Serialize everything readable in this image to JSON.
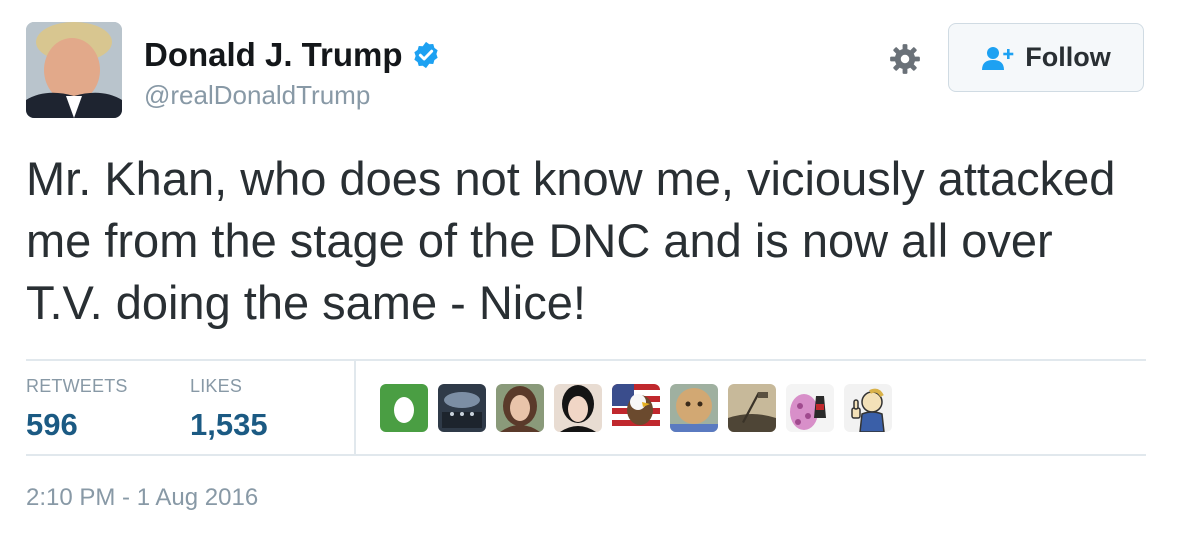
{
  "user": {
    "name": "Donald J. Trump",
    "handle": "@realDonaldTrump",
    "verified": true
  },
  "actions": {
    "follow_label": "Follow"
  },
  "tweet": {
    "text": "Mr. Khan, who does not know me, viciously attacked me from the stage of the DNC and is now all over T.V. doing the same - Nice!"
  },
  "stats": {
    "retweets_label": "RETWEETS",
    "retweets_value": "596",
    "likes_label": "LIKES",
    "likes_value": "1,535"
  },
  "likers": [
    {
      "name": "liker-egg-avatar",
      "color": "#4a9e43"
    },
    {
      "name": "liker-stage-avatar",
      "color": "#2f3a48"
    },
    {
      "name": "liker-woman-avatar",
      "color": "#6b4a3a"
    },
    {
      "name": "liker-woman2-avatar",
      "color": "#d9c7b9"
    },
    {
      "name": "liker-eagle-flag-avatar",
      "color": "#3a4d8c"
    },
    {
      "name": "liker-doll-avatar",
      "color": "#c6a173"
    },
    {
      "name": "liker-iwojima-avatar",
      "color": "#8a7a5e"
    },
    {
      "name": "liker-pink-avatar",
      "color": "#d88fc9"
    },
    {
      "name": "liker-cartoon-avatar",
      "color": "#e8e2c8"
    }
  ],
  "timestamp": "2:10 PM - 1 Aug 2016",
  "colors": {
    "verified_blue": "#1da1f2",
    "stat_value": "#1b5a83",
    "muted": "#8899a6"
  }
}
